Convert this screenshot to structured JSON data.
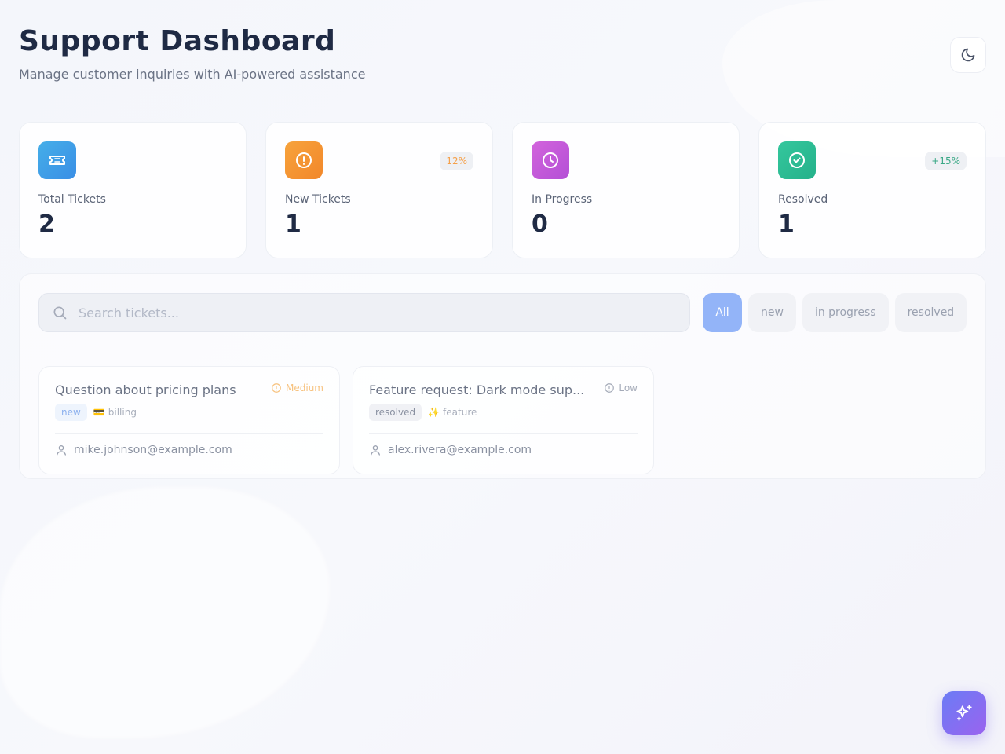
{
  "header": {
    "title": "Support Dashboard",
    "subtitle": "Manage customer inquiries with AI-powered assistance"
  },
  "icons": {
    "theme_toggle": "moon-icon",
    "search": "search-icon",
    "ai_assistant": "sparkles-icon",
    "user": "user-icon"
  },
  "stats": [
    {
      "label": "Total Tickets",
      "value": "2",
      "icon": "ticket-icon",
      "color": "#3b9ee6",
      "badge": null
    },
    {
      "label": "New Tickets",
      "value": "1",
      "icon": "alert-circle-icon",
      "color": "#f59a31",
      "badge": "12%",
      "badge_color": "#f5a04a"
    },
    {
      "label": "In Progress",
      "value": "0",
      "icon": "clock-icon",
      "color": "#c65ad9",
      "badge": null
    },
    {
      "label": "Resolved",
      "value": "1",
      "icon": "check-circle-icon",
      "color": "#2fbf97",
      "badge": "+15%",
      "badge_color": "#3aa886"
    }
  ],
  "search": {
    "placeholder": "Search tickets..."
  },
  "filters": [
    {
      "label": "All",
      "active": true
    },
    {
      "label": "new",
      "active": false
    },
    {
      "label": "in progress",
      "active": false
    },
    {
      "label": "resolved",
      "active": false
    }
  ],
  "tickets": [
    {
      "title": "Question about pricing plans",
      "priority": "Medium",
      "priority_color": "#f7c27f",
      "status": "new",
      "status_color": "#8db1ee",
      "status_bg": "#eef4fd",
      "category": "billing",
      "category_icon": "💳",
      "email": "mike.johnson@example.com"
    },
    {
      "title": "Feature request: Dark mode sup...",
      "priority": "Low",
      "priority_color": "#a4aab8",
      "status": "resolved",
      "status_color": "#8a91a1",
      "status_bg": "#f0f1f5",
      "category": "feature",
      "category_icon": "✨",
      "email": "alex.rivera@example.com"
    }
  ],
  "colors": {
    "accent": "#93b4f8",
    "fab_start": "#6b7cf5",
    "fab_end": "#9a63ef"
  }
}
